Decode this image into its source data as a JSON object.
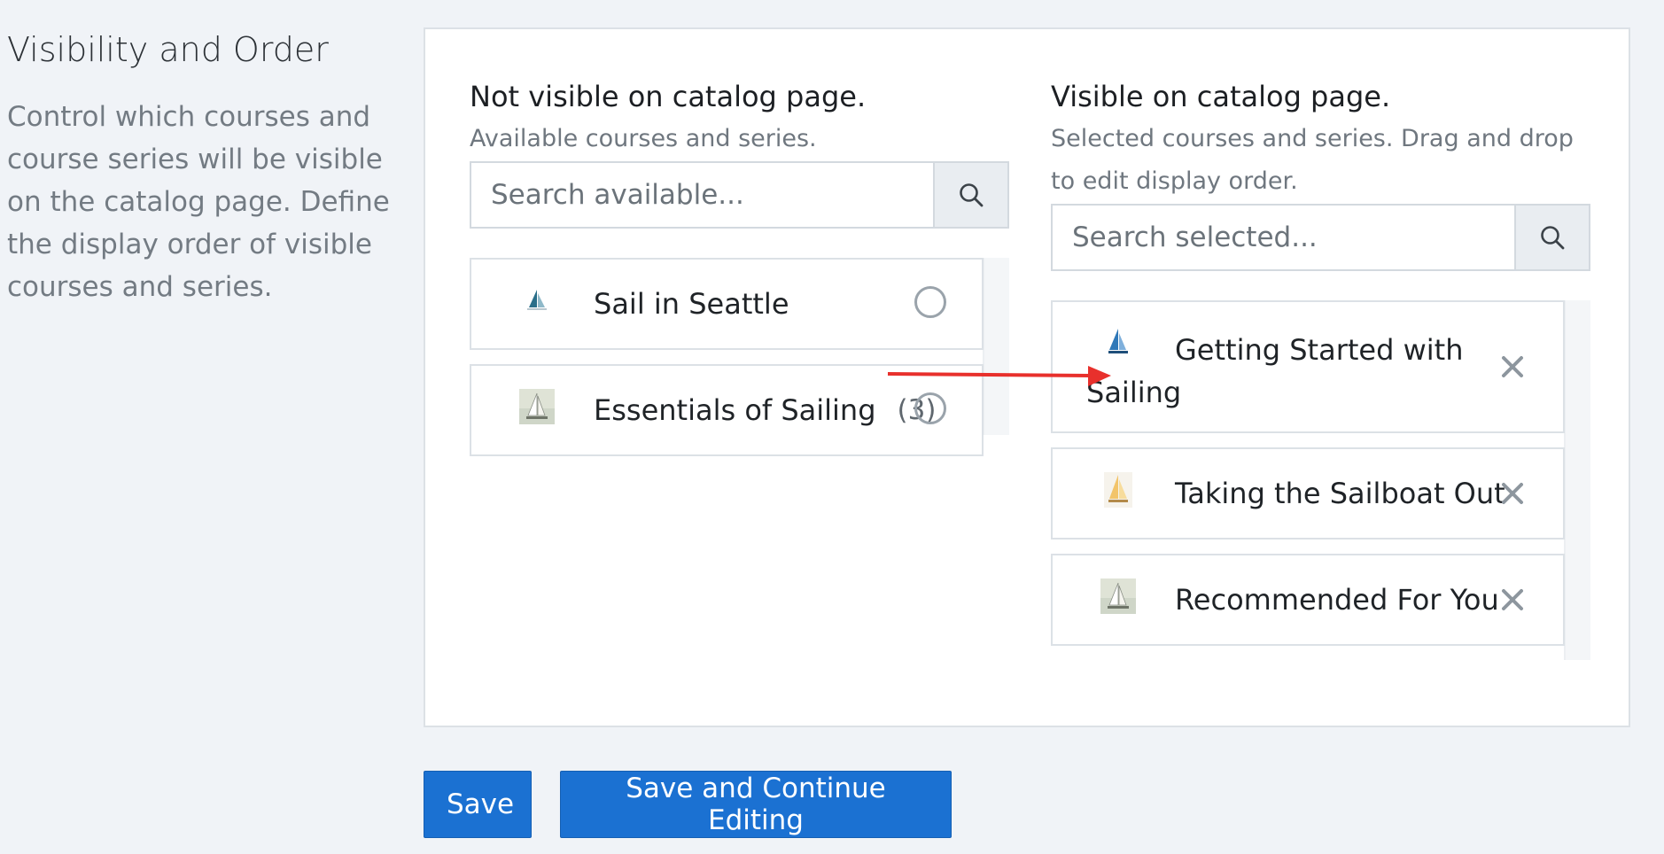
{
  "section": {
    "title": "Visibility and Order",
    "description": "Control which courses and course series will be visible on the catalog page. Define the display order of visible courses and series."
  },
  "available": {
    "title": "Not visible on catalog page.",
    "subtitle": "Available courses and series.",
    "search_placeholder": "Search available...",
    "items": [
      {
        "name": "Sail in Seattle",
        "count": "",
        "icon": "sailboat-icon"
      },
      {
        "name": "Essentials of Sailing",
        "count": "(3)",
        "icon": "sailboat-photo-icon"
      }
    ]
  },
  "selected": {
    "title": "Visible on catalog page.",
    "subtitle": "Selected courses and series. Drag and drop to edit display order.",
    "search_placeholder": "Search selected...",
    "items": [
      {
        "name_line1": "Getting Started with",
        "name_line2": "Sailing",
        "icon": "sailboat-icon"
      },
      {
        "name": "Taking the Sailboat Out",
        "icon": "sailboat-icon"
      },
      {
        "name": "Recommended For You",
        "icon": "sailboat-photo-icon"
      }
    ]
  },
  "buttons": {
    "save": "Save",
    "save_continue": "Save and Continue Editing"
  },
  "colors": {
    "primary": "#1b71d2",
    "annotation_arrow": "#e8302c"
  }
}
